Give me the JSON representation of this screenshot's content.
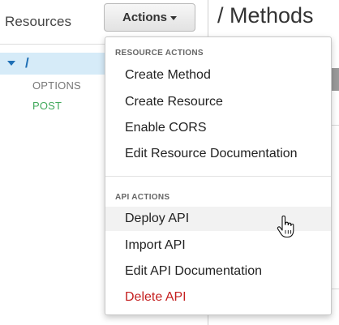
{
  "left_panel": {
    "title": "Resources",
    "root_resource": "/",
    "methods": [
      "OPTIONS",
      "POST"
    ]
  },
  "content": {
    "title": "/ Methods"
  },
  "actions_button": {
    "label": "Actions"
  },
  "dropdown": {
    "resource_actions_header": "RESOURCE ACTIONS",
    "resource_actions": [
      "Create Method",
      "Create Resource",
      "Enable CORS",
      "Edit Resource Documentation"
    ],
    "api_actions_header": "API ACTIONS",
    "api_actions": [
      "Deploy API",
      "Import API",
      "Edit API Documentation",
      "Delete API"
    ],
    "hovered_item": "Deploy API"
  },
  "colors": {
    "selected_row": "#d6ebf8",
    "link_blue": "#1f6fb5",
    "post_green": "#42a95c",
    "danger_red": "#c41f1f"
  },
  "icons": {
    "tree_toggle": "caret-down-icon",
    "button_caret": "caret-down-icon",
    "pointer": "hand-pointer-icon"
  }
}
